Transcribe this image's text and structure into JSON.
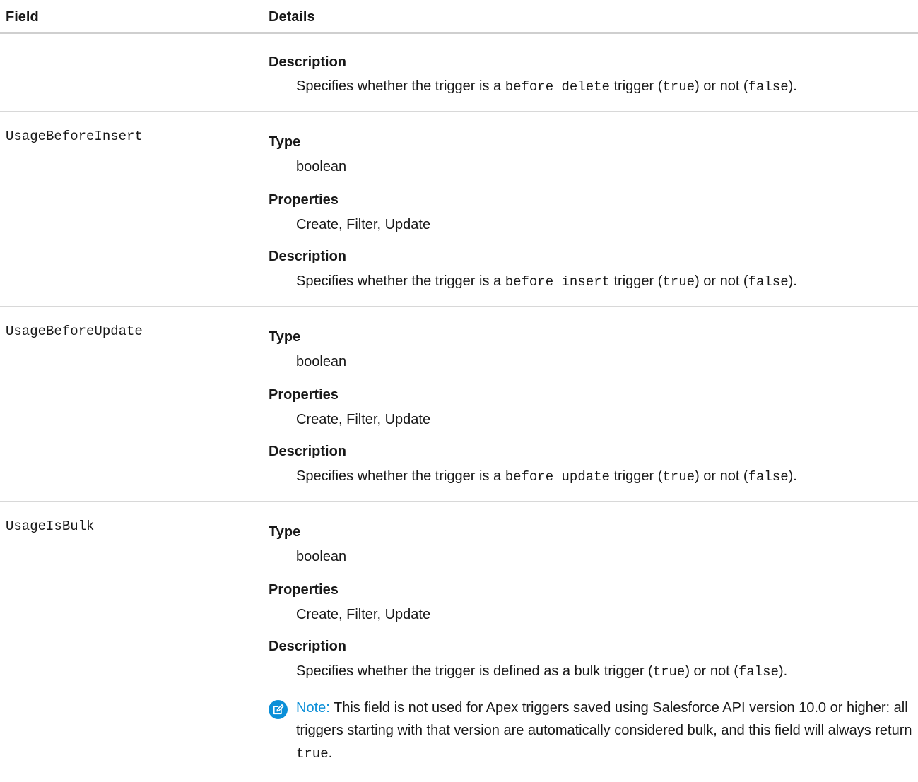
{
  "header": {
    "field": "Field",
    "details": "Details"
  },
  "labels": {
    "type": "Type",
    "properties": "Properties",
    "description": "Description"
  },
  "rows": [
    {
      "description": {
        "pre": "Specifies whether the trigger is a ",
        "code": "before delete",
        "mid": " trigger (",
        "true": "true",
        "mid2": ") or not (",
        "false": "false",
        "post": ")."
      }
    },
    {
      "field": "UsageBeforeInsert",
      "type": "boolean",
      "properties": "Create, Filter, Update",
      "description": {
        "pre": "Specifies whether the trigger is a ",
        "code": "before insert",
        "mid": " trigger (",
        "true": "true",
        "mid2": ") or not (",
        "false": "false",
        "post": ")."
      }
    },
    {
      "field": "UsageBeforeUpdate",
      "type": "boolean",
      "properties": "Create, Filter, Update",
      "description": {
        "pre": "Specifies whether the trigger is a ",
        "code": "before update",
        "mid": " trigger (",
        "true": "true",
        "mid2": ") or not (",
        "false": "false",
        "post": ")."
      }
    },
    {
      "field": "UsageIsBulk",
      "type": "boolean",
      "properties": "Create, Filter, Update",
      "description": {
        "pre": "Specifies whether the trigger is defined as a bulk trigger (",
        "true": "true",
        "mid2": ") or not (",
        "false": "false",
        "post": ")."
      },
      "note": {
        "label": "Note:",
        "text": " This field is not used for Apex triggers saved using Salesforce API version 10.0 or higher: all triggers starting with that version are automatically considered bulk, and this field will always return ",
        "code": "true",
        "post": "."
      }
    }
  ],
  "icons": {
    "note": "note-pencil-icon"
  },
  "colors": {
    "note_accent": "#0b8fd8",
    "rule": "#d8d8d8"
  }
}
